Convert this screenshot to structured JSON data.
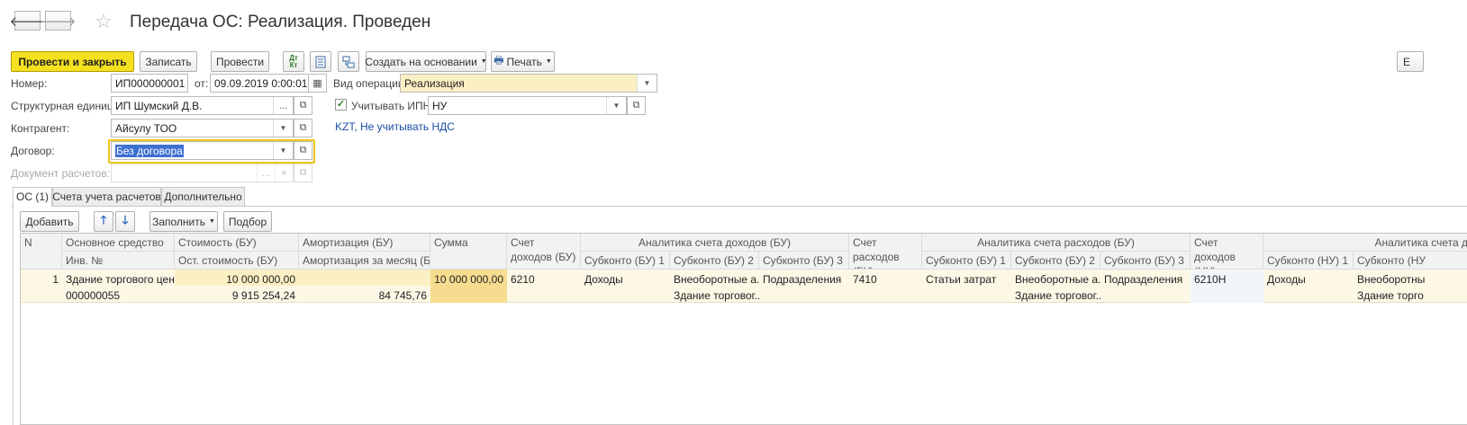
{
  "window": {
    "title": "Передача ОС: Реализация. Проведен"
  },
  "toolbar": {
    "post_close": "Провести и закрыть",
    "save": "Записать",
    "post": "Провести",
    "create_based": "Создать на основании",
    "print": "Печать",
    "dtkt_icon": "Дт Кт",
    "more_cut": "Е"
  },
  "form": {
    "number_label": "Номер:",
    "number": "ИП000000001",
    "date_label": "от:",
    "date": "09.09.2019  0:00:01",
    "op_label": "Вид операции:",
    "op": "Реализация",
    "unit_label": "Структурная единица:",
    "unit": "ИП Шумский Д.В.",
    "ipn_label": "Учитывать ИПН",
    "ipn": "НУ",
    "counterparty_label": "Контрагент:",
    "counterparty": "Айсулу ТОО",
    "vat_link": "KZT, Не учитывать НДС",
    "contract_label": "Договор:",
    "contract": "Без договора",
    "settlement_label": "Документ расчетов:"
  },
  "tabs": [
    "ОС (1)",
    "Счета учета расчетов",
    "Дополнительно"
  ],
  "table_toolbar": {
    "add": "Добавить",
    "fill": "Заполнить",
    "select": "Подбор"
  },
  "table": {
    "headers": {
      "n": "N",
      "asset": "Основное средство",
      "inv": "Инв. №",
      "cost": "Стоимость (БУ)",
      "residual": "Ост. стоимость (БУ)",
      "amort": "Амортизация (БУ)",
      "amort_month": "Амортизация за месяц (БУ)",
      "sum": "Сумма",
      "income_acc": "Счет доходов (БУ)",
      "income_analytics": "Аналитика счета доходов (БУ)",
      "sub1": "Субконто (БУ) 1",
      "sub2": "Субконто (БУ) 2",
      "sub3": "Субконто (БУ) 3",
      "expense_acc": "Счет расходов (БУ)",
      "expense_analytics": "Аналитика счета расходов (БУ)",
      "esub1": "Субконто (БУ) 1",
      "esub2": "Субконто (БУ) 2",
      "esub3": "Субконто (БУ) 3",
      "income_acc_nu": "Счет доходов (НУ)",
      "income_analytics_nu": "Аналитика счета д",
      "nsub1": "Субконто (НУ) 1",
      "nsub2": "Субконто (НУ"
    },
    "row": {
      "n": "1",
      "asset": "Здание торгового цен...",
      "inv": "000000055",
      "cost": "10 000 000,00",
      "residual": "9 915 254,24",
      "amort": "",
      "amort_month": "84 745,76",
      "sum": "10 000 000,00",
      "income_acc": "6210",
      "sub1": "Доходы",
      "sub2": "Внеоборотные а...",
      "sub2b": "Здание торговог...",
      "sub3": "Подразделения",
      "expense_acc": "7410",
      "esub1": "Статьи затрат",
      "esub2": "Внеоборотные а...",
      "esub2b": "Здание торговог...",
      "esub3": "Подразделения",
      "income_acc_nu": "6210Н",
      "nsub1": "Доходы",
      "nsub2": "Внеоборотны",
      "nsub2b": "Здание торго"
    }
  }
}
